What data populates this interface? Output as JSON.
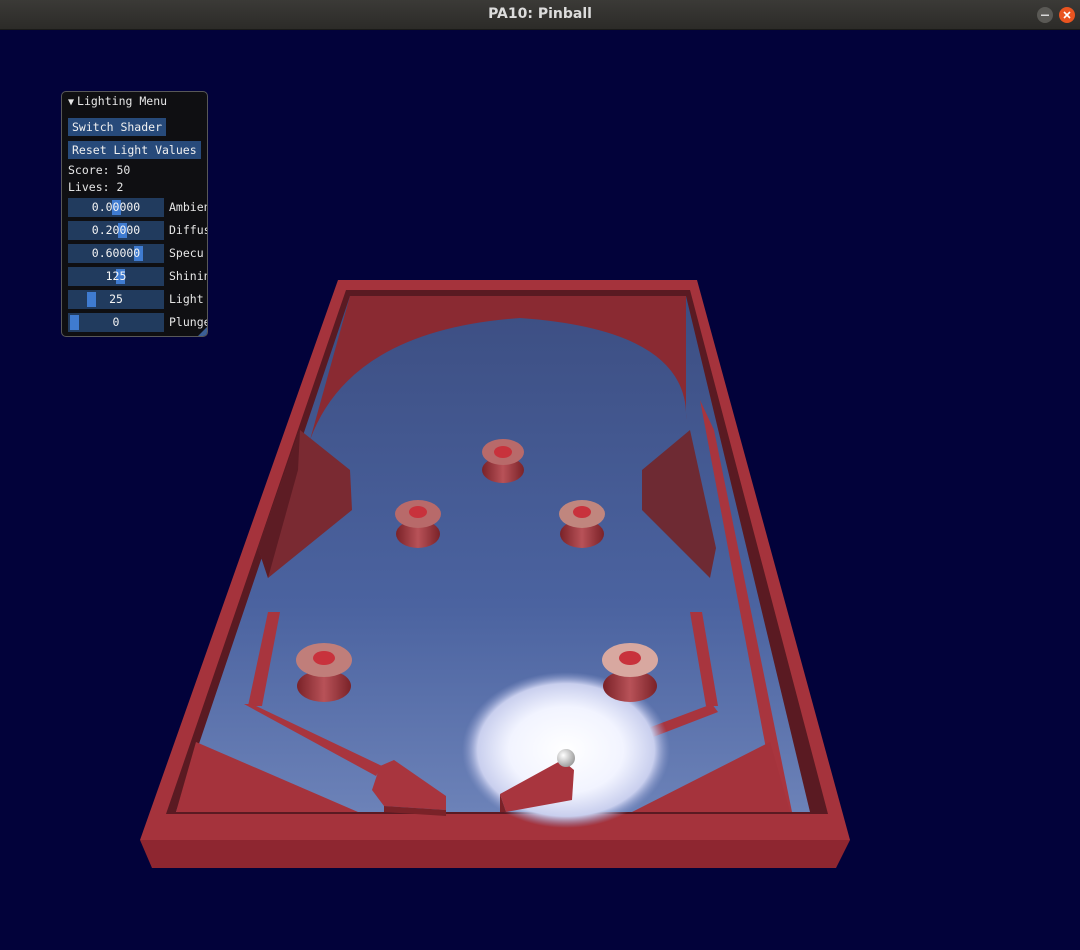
{
  "window": {
    "title": "PA10: Pinball",
    "minimize_icon": "minimize-icon",
    "close_icon": "close-icon",
    "colors": {
      "titlebar": "#2f2e2b",
      "close": "#e95420",
      "background": "#02023a"
    }
  },
  "lighting_menu": {
    "header": "Lighting Menu",
    "collapse_icon": "triangle-down-icon",
    "switch_shader_label": "Switch Shader",
    "reset_label": "Reset Light Values",
    "score_text": "Score: 50",
    "lives_text": "Lives: 2",
    "sliders": [
      {
        "value_text": "0.00000",
        "label": "Ambien",
        "fraction": 0.5
      },
      {
        "value_text": "0.20000",
        "label": "Diffus",
        "fraction": 0.58
      },
      {
        "value_text": "0.60000",
        "label": "Specu",
        "fraction": 0.77
      },
      {
        "value_text": "125",
        "label": "Shinin",
        "fraction": 0.55
      },
      {
        "value_text": "25",
        "label": "Light",
        "fraction": 0.2
      },
      {
        "value_text": "0",
        "label": "Plunge",
        "fraction": 0.0
      }
    ]
  },
  "scene": {
    "table_color": "#a0303a",
    "playfield_color": "#45598f",
    "objects": [
      "pinball-table",
      "bumper",
      "flipper",
      "ball",
      "spotlight"
    ]
  }
}
